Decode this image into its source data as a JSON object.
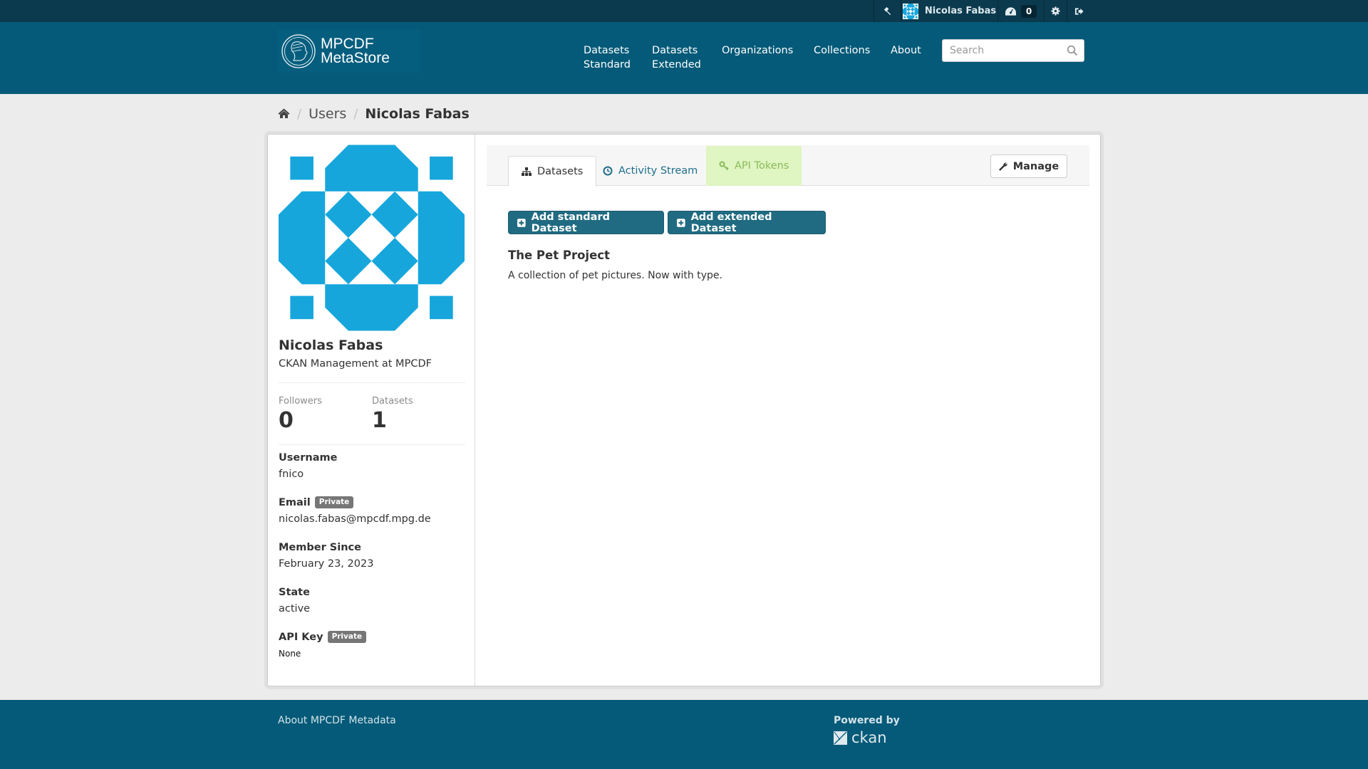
{
  "account_bar": {
    "admin_icon": "gavel-icon",
    "user_name": "Nicolas Fabas",
    "dashboard_icon": "dashboard-icon",
    "dashboard_count": "0",
    "settings_icon": "gear-icon",
    "logout_icon": "sign-out-icon"
  },
  "masthead": {
    "logo_line1": "MPCDF",
    "logo_line2": "MetaStore",
    "nav": [
      {
        "line1": "Datasets",
        "line2": "Standard"
      },
      {
        "line1": "Datasets",
        "line2": "Extended"
      },
      {
        "line1": "Organizations",
        "line2": ""
      },
      {
        "line1": "Collections",
        "line2": ""
      },
      {
        "line1": "About",
        "line2": ""
      }
    ],
    "search": {
      "placeholder": "Search",
      "value": ""
    }
  },
  "breadcrumb": {
    "home_icon": "home-icon",
    "items": [
      "Users",
      "Nicolas Fabas"
    ]
  },
  "profile": {
    "avatar_color": "#16a6dc",
    "name": "Nicolas Fabas",
    "about": "CKAN Management at MPCDF",
    "stats": [
      {
        "label": "Followers",
        "value": "0"
      },
      {
        "label": "Datasets",
        "value": "1"
      }
    ],
    "info": [
      {
        "label": "Username",
        "value": "fnico",
        "private": false
      },
      {
        "label": "Email",
        "value": "nicolas.fabas@mpcdf.mpg.de",
        "private": true
      },
      {
        "label": "Member Since",
        "value": "February 23, 2023",
        "private": false
      },
      {
        "label": "State",
        "value": "active",
        "private": false
      },
      {
        "label": "API Key",
        "value": "None",
        "private": true
      }
    ],
    "private_label": "Private"
  },
  "tabs": [
    {
      "label": "Datasets",
      "icon": "sitemap-icon",
      "active": true
    },
    {
      "label": "Activity Stream",
      "icon": "clock-icon",
      "active": false
    },
    {
      "label": "API Tokens",
      "icon": "key-icon",
      "active": false,
      "highlighted": true
    }
  ],
  "manage_button": "Manage",
  "actions": {
    "add_standard": "Add standard Dataset",
    "add_extended": "Add extended Dataset"
  },
  "datasets": [
    {
      "title": "The Pet Project",
      "notes": "A collection of pet pictures. Now with type."
    }
  ],
  "footer": {
    "about_link": "About MPCDF Metadata",
    "powered_by": "Powered by",
    "ckan": "ckan"
  },
  "colors": {
    "masthead": "#045a78",
    "account_bar": "#0b3a4e",
    "primary_button": "#206b82",
    "link": "#1f6e8a",
    "tab_highlight": "#dff5c2"
  }
}
